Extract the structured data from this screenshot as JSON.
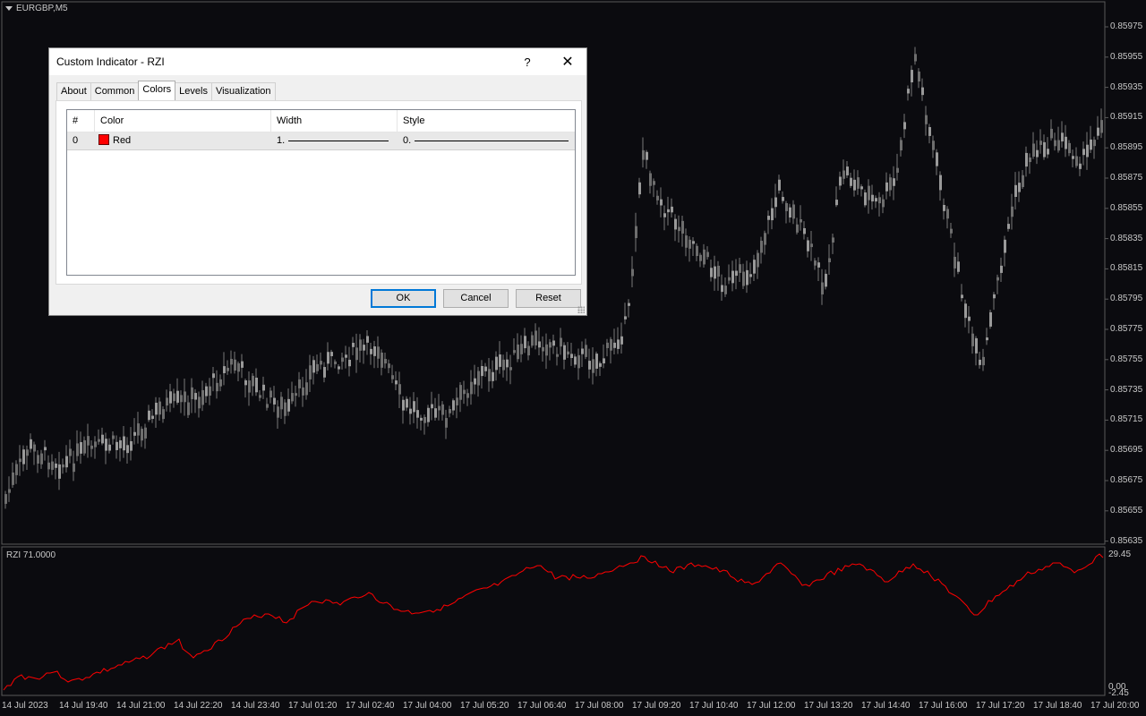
{
  "chart": {
    "symbol": "EURGBP,M5",
    "price_labels": [
      "0.85975",
      "0.85955",
      "0.85935",
      "0.85915",
      "0.85895",
      "0.85875",
      "0.85855",
      "0.85835",
      "0.85815",
      "0.85795",
      "0.85775",
      "0.85755",
      "0.85735",
      "0.85715",
      "0.85695",
      "0.85675",
      "0.85655",
      "0.85635"
    ],
    "time_labels": [
      "14 Jul 2023",
      "14 Jul 19:40",
      "14 Jul 21:00",
      "14 Jul 22:20",
      "14 Jul 23:40",
      "17 Jul 01:20",
      "17 Jul 02:40",
      "17 Jul 04:00",
      "17 Jul 05:20",
      "17 Jul 06:40",
      "17 Jul 08:00",
      "17 Jul 09:20",
      "17 Jul 10:40",
      "17 Jul 12:00",
      "17 Jul 13:20",
      "17 Jul 14:40",
      "17 Jul 16:00",
      "17 Jul 17:20",
      "17 Jul 18:40",
      "17 Jul 20:00"
    ],
    "candle_color": "#8c8c8c",
    "background": "#0b0b0f"
  },
  "indicator": {
    "label": "RZI 71.0000",
    "scale_top": "29.45",
    "scale_mid": "0.00",
    "scale_bottom": "-2.45",
    "line_color": "#ff0000"
  },
  "dialog": {
    "title": "Custom Indicator - RZI",
    "help": "?",
    "close": "✕",
    "tabs": [
      "About",
      "Common",
      "Colors",
      "Levels",
      "Visualization"
    ],
    "active_tab": "Colors",
    "columns": [
      "#",
      "Color",
      "Width",
      "Style"
    ],
    "row": {
      "index": "0",
      "color_name": "Red",
      "width": "1.",
      "style": "0."
    },
    "buttons": {
      "ok": "OK",
      "cancel": "Cancel",
      "reset": "Reset"
    }
  }
}
